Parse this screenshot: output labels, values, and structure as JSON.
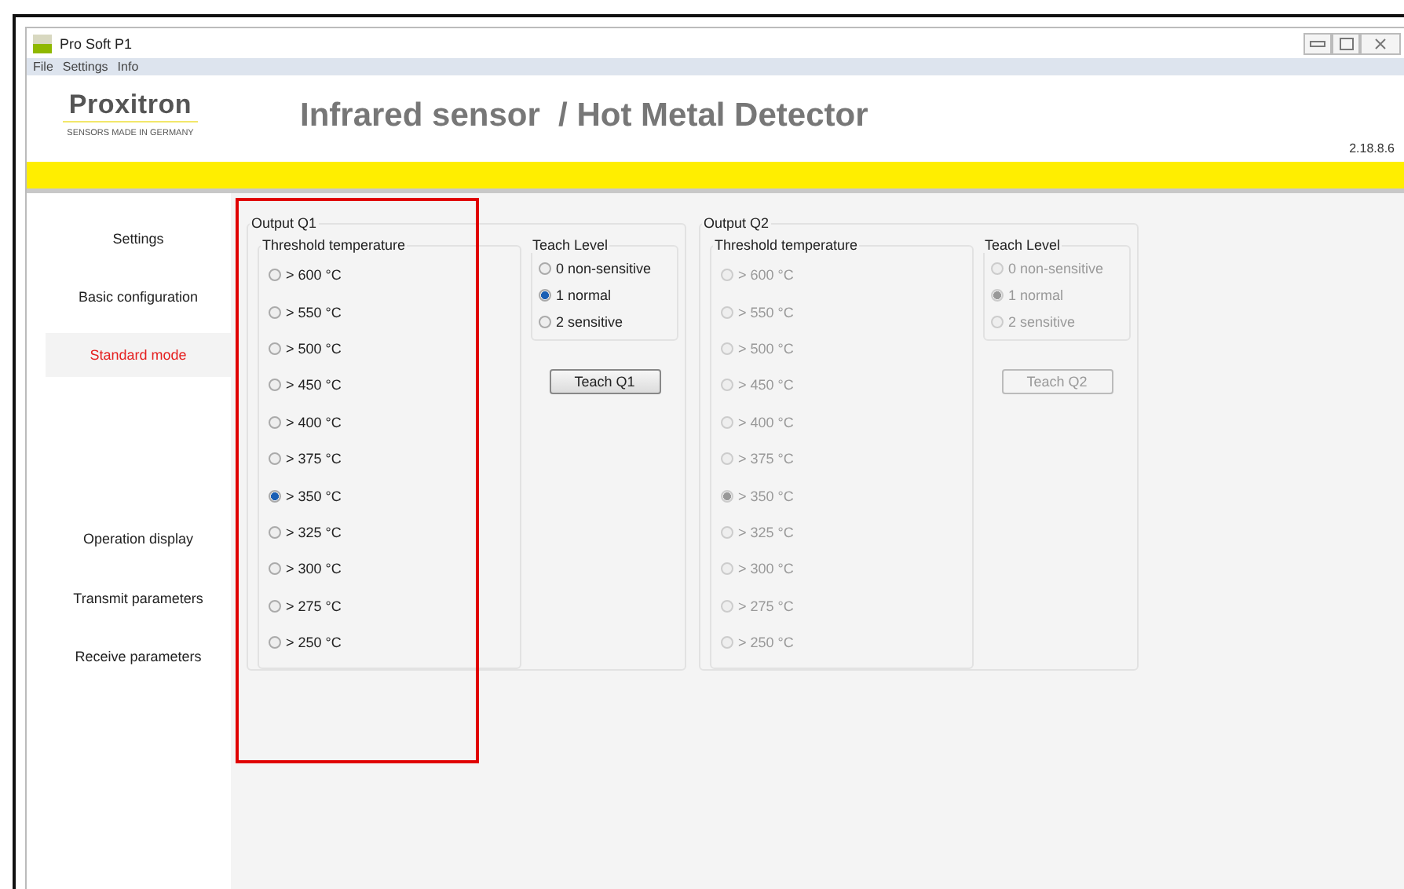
{
  "window": {
    "title": "Pro Soft P1"
  },
  "menu": [
    "File",
    "Settings",
    "Info"
  ],
  "header": {
    "logo": "Proxitron",
    "tagline": "SENSORS MADE IN GERMANY",
    "title": "Infrared sensor  / Hot Metal Detector",
    "version": "2.18.8.6"
  },
  "sidebar": {
    "items": [
      {
        "label": "Settings",
        "selected": false
      },
      {
        "label": "Basic configuration",
        "selected": false
      },
      {
        "label": "Standard mode",
        "selected": true
      },
      {
        "label": "Operation display",
        "selected": false
      },
      {
        "label": "Transmit parameters",
        "selected": false
      },
      {
        "label": "Receive parameters",
        "selected": false
      }
    ]
  },
  "outputs": [
    {
      "title": "Output Q1",
      "disabled": false,
      "threshold_title": "Threshold temperature",
      "thresholds": [
        {
          "label": "> 600 °C",
          "selected": false
        },
        {
          "label": "> 550 °C",
          "selected": false
        },
        {
          "label": "> 500 °C",
          "selected": false
        },
        {
          "label": "> 450 °C",
          "selected": false
        },
        {
          "label": "> 400 °C",
          "selected": false
        },
        {
          "label": "> 375 °C",
          "selected": false
        },
        {
          "label": "> 350 °C",
          "selected": true
        },
        {
          "label": "> 325 °C",
          "selected": false
        },
        {
          "label": "> 300 °C",
          "selected": false
        },
        {
          "label": "> 275 °C",
          "selected": false
        },
        {
          "label": "> 250 °C",
          "selected": false
        }
      ],
      "teach_title": "Teach Level",
      "teach_levels": [
        {
          "label": "0 non-sensitive",
          "selected": false
        },
        {
          "label": "1 normal",
          "selected": true
        },
        {
          "label": "2 sensitive",
          "selected": false
        }
      ],
      "button": "Teach Q1"
    },
    {
      "title": "Output Q2",
      "disabled": true,
      "threshold_title": "Threshold temperature",
      "thresholds": [
        {
          "label": "> 600 °C",
          "selected": false
        },
        {
          "label": "> 550 °C",
          "selected": false
        },
        {
          "label": "> 500 °C",
          "selected": false
        },
        {
          "label": "> 450 °C",
          "selected": false
        },
        {
          "label": "> 400 °C",
          "selected": false
        },
        {
          "label": "> 375 °C",
          "selected": false
        },
        {
          "label": "> 350 °C",
          "selected": true
        },
        {
          "label": "> 325 °C",
          "selected": false
        },
        {
          "label": "> 300 °C",
          "selected": false
        },
        {
          "label": "> 275 °C",
          "selected": false
        },
        {
          "label": "> 250 °C",
          "selected": false
        }
      ],
      "teach_title": "Teach Level",
      "teach_levels": [
        {
          "label": "0 non-sensitive",
          "selected": false
        },
        {
          "label": "1 normal",
          "selected": true
        },
        {
          "label": "2 sensitive",
          "selected": false
        }
      ],
      "button": "Teach Q2"
    }
  ]
}
